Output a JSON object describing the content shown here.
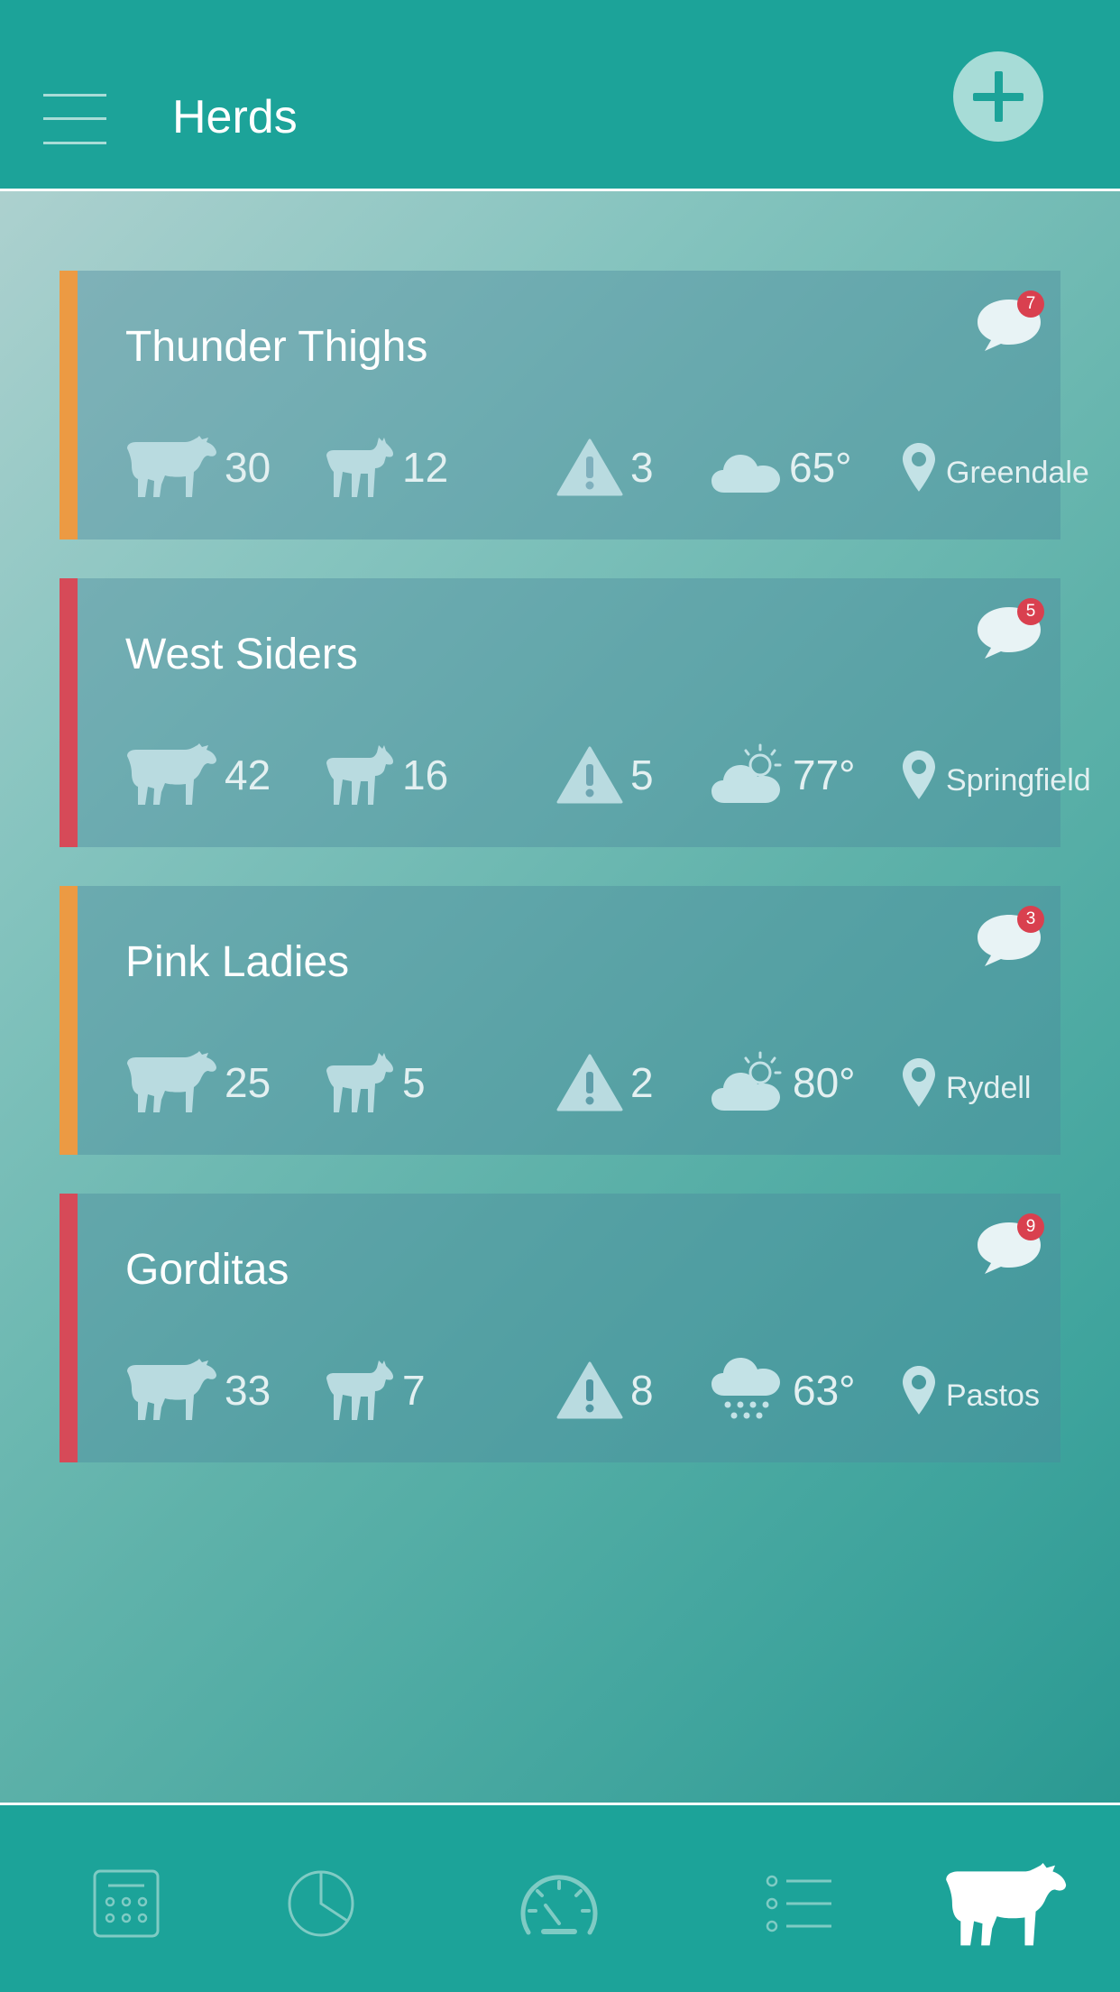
{
  "header": {
    "title": "Herds"
  },
  "colors": {
    "accent": "#1ca399",
    "orange": "#ec9a43",
    "red": "#d64a58",
    "icon": "#b9dbe0"
  },
  "herds": [
    {
      "name": "Thunder Thighs",
      "cattle": "30",
      "goats": "12",
      "alerts": "3",
      "weather": "cloud-icon",
      "temp": "65°",
      "location": "Greendale",
      "messages": "7",
      "status": "orange"
    },
    {
      "name": "West Siders",
      "cattle": "42",
      "goats": "16",
      "alerts": "5",
      "weather": "partly-sunny-icon",
      "temp": "77°",
      "location": "Springfield",
      "messages": "5",
      "status": "red"
    },
    {
      "name": "Pink Ladies",
      "cattle": "25",
      "goats": "5",
      "alerts": "2",
      "weather": "partly-sunny-icon",
      "temp": "80°",
      "location": "Rydell",
      "messages": "3",
      "status": "orange"
    },
    {
      "name": "Gorditas",
      "cattle": "33",
      "goats": "7",
      "alerts": "8",
      "weather": "rain-icon",
      "temp": "63°",
      "location": "Pastos",
      "messages": "9",
      "status": "red"
    }
  ],
  "nav": [
    "calendar-icon",
    "pie-chart-icon",
    "gauge-icon",
    "list-icon",
    "cow-icon"
  ],
  "nav_active": "cow-icon"
}
